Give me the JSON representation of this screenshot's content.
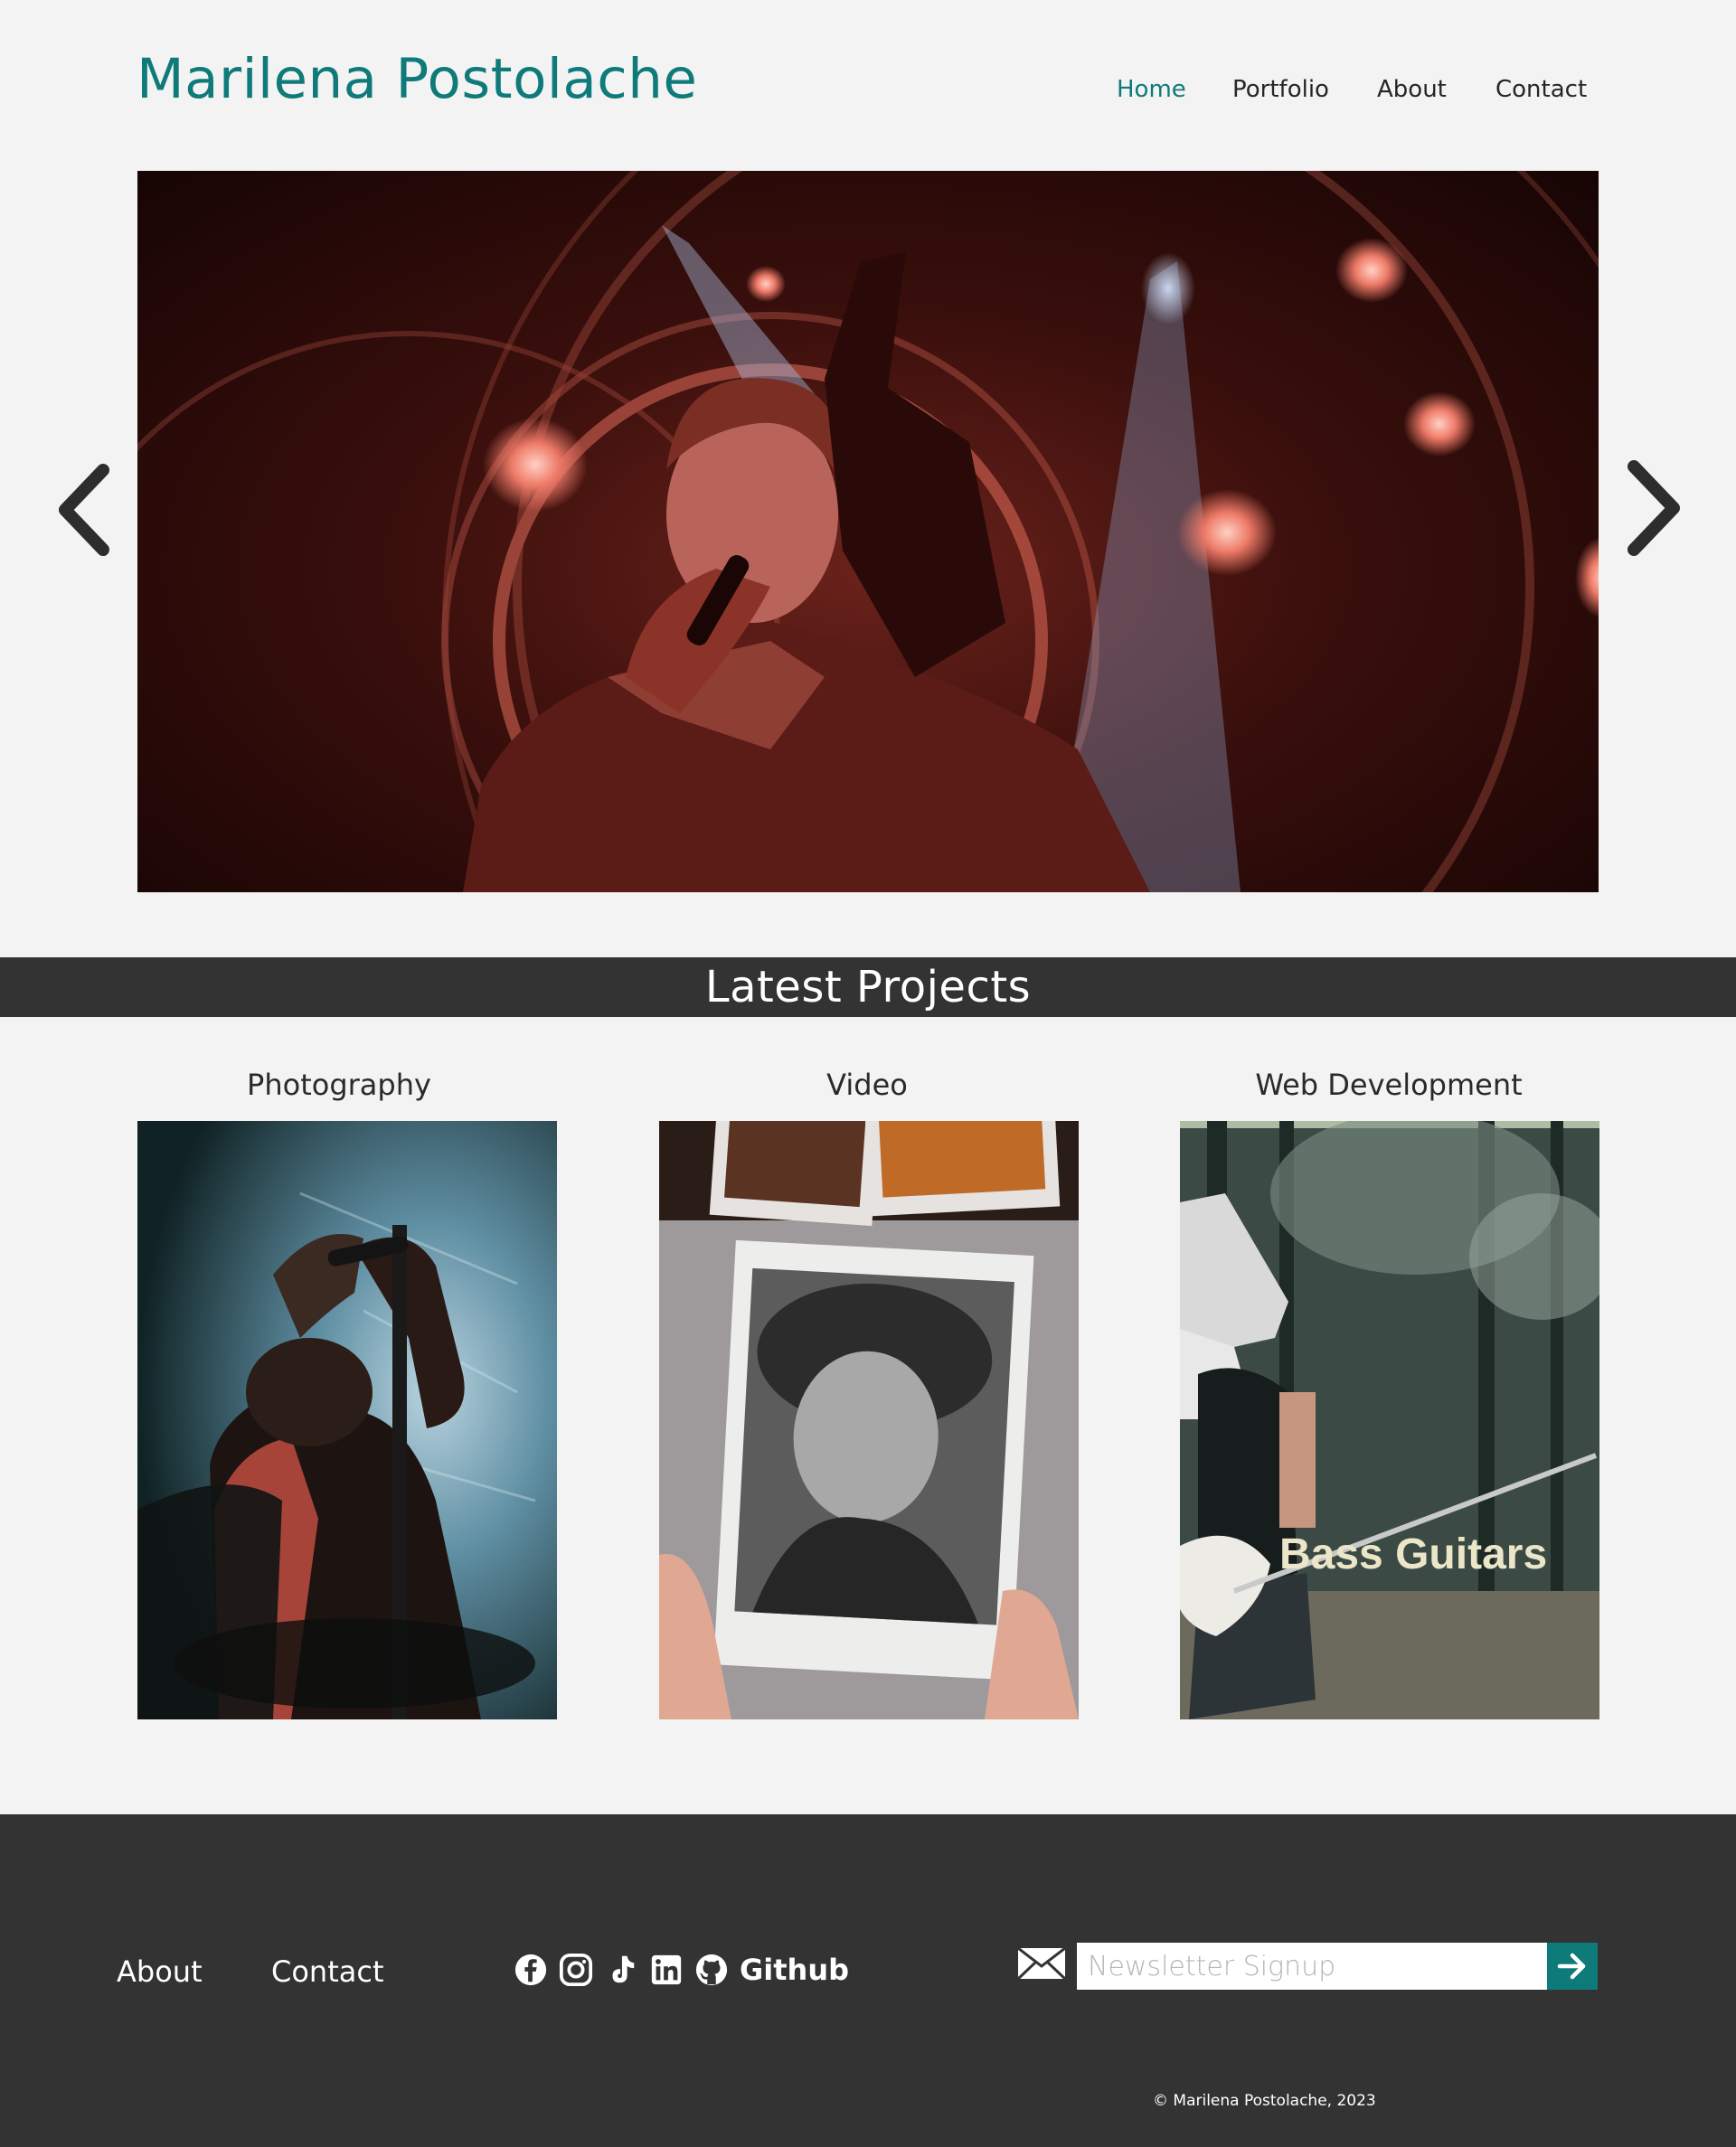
{
  "colors": {
    "accent": "#0f7a7a",
    "background": "#f3f3f3",
    "dark_band": "#333333",
    "text": "#2e2e2e"
  },
  "header": {
    "title": "Marilena Postolache",
    "nav": [
      {
        "label": "Home",
        "active": true
      },
      {
        "label": "Portfolio",
        "active": false
      },
      {
        "label": "About",
        "active": false
      },
      {
        "label": "Contact",
        "active": false
      }
    ]
  },
  "hero": {
    "prev_icon": "chevron-left-icon",
    "next_icon": "chevron-right-icon"
  },
  "projects": {
    "heading": "Latest Projects",
    "items": [
      {
        "label": "Photography"
      },
      {
        "label": "Video"
      },
      {
        "label": "Web Development",
        "image_text": "Bass Guitars"
      }
    ]
  },
  "footer": {
    "links": [
      "About",
      "Contact"
    ],
    "social_icons": [
      "facebook-icon",
      "instagram-icon",
      "tiktok-icon",
      "linkedin-icon",
      "github-icon"
    ],
    "github_label": "Github",
    "newsletter": {
      "icon": "envelope-icon",
      "placeholder": "Newsletter Signup",
      "submit_icon": "arrow-right-icon"
    },
    "copyright": "© Marilena Postolache, 2023"
  }
}
